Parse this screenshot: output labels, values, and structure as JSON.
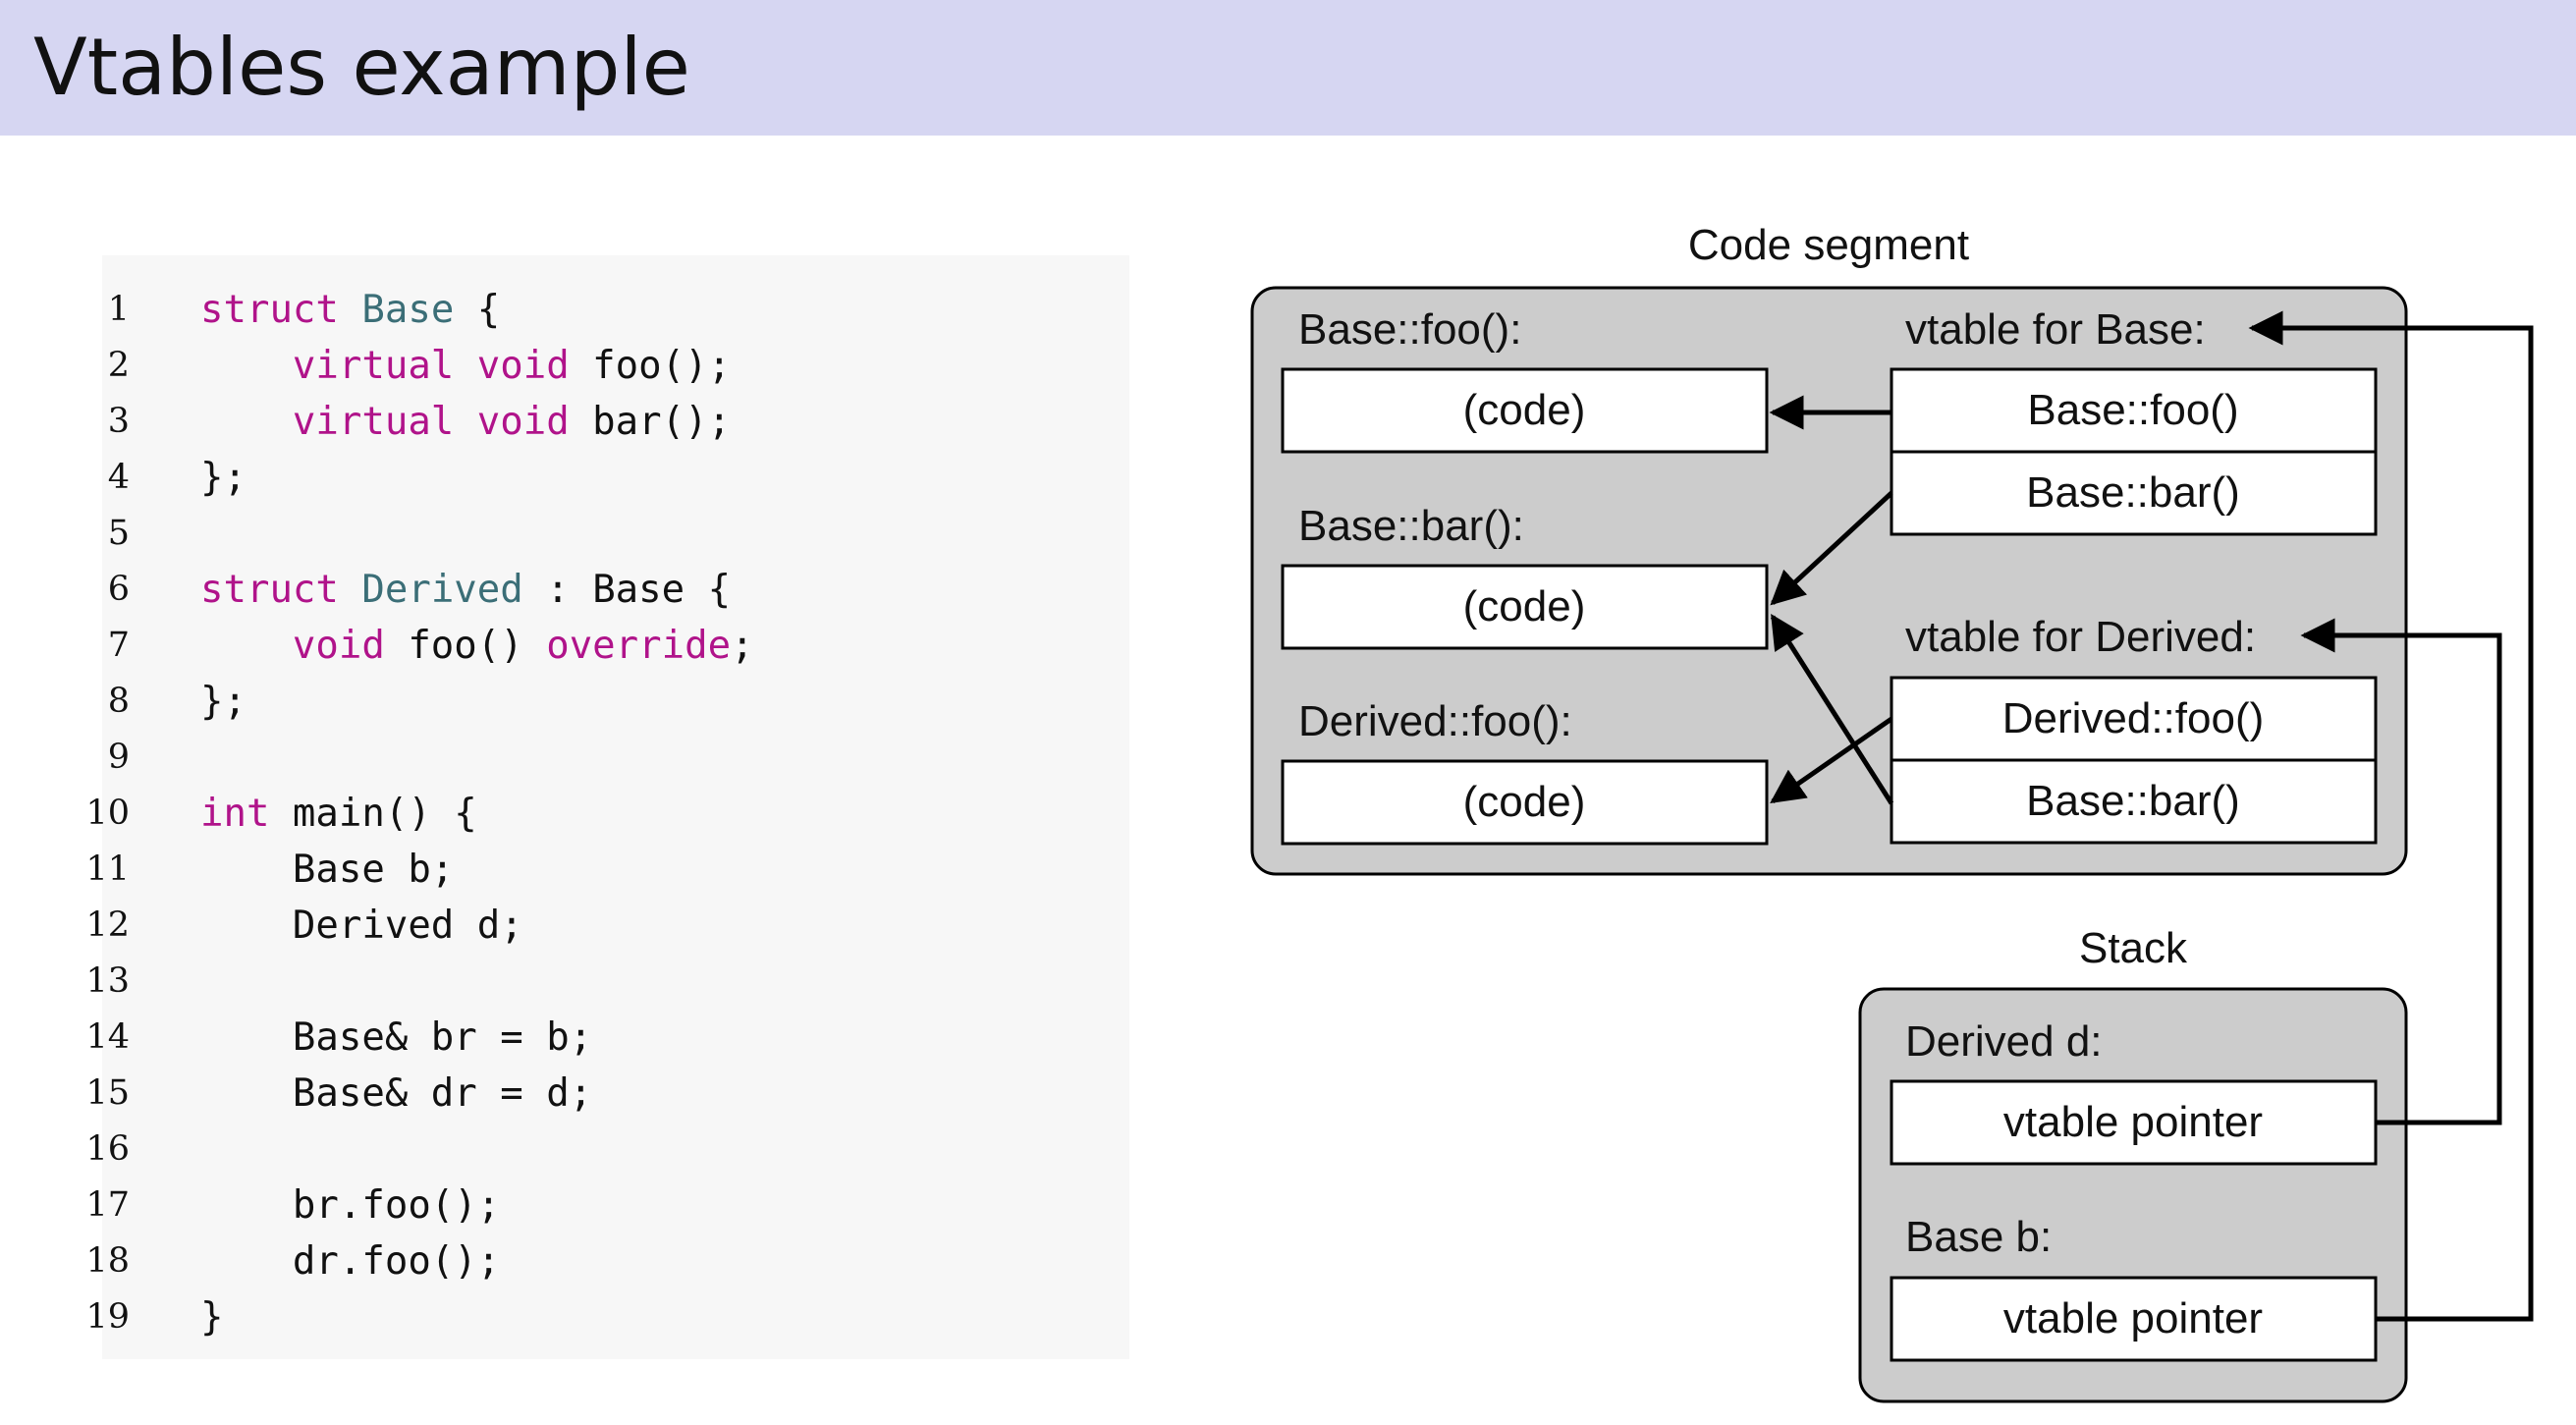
{
  "slide": {
    "title": "Vtables example"
  },
  "code": {
    "lines": [
      {
        "num": "1",
        "tokens": [
          {
            "t": "struct",
            "c": "kw"
          },
          {
            "t": " "
          },
          {
            "t": "Base",
            "c": "ty"
          },
          {
            "t": " {"
          }
        ]
      },
      {
        "num": "2",
        "tokens": [
          {
            "t": "    "
          },
          {
            "t": "virtual",
            "c": "kw"
          },
          {
            "t": " "
          },
          {
            "t": "void",
            "c": "kw"
          },
          {
            "t": " foo();"
          }
        ]
      },
      {
        "num": "3",
        "tokens": [
          {
            "t": "    "
          },
          {
            "t": "virtual",
            "c": "kw"
          },
          {
            "t": " "
          },
          {
            "t": "void",
            "c": "kw"
          },
          {
            "t": " bar();"
          }
        ]
      },
      {
        "num": "4",
        "tokens": [
          {
            "t": "};"
          }
        ]
      },
      {
        "num": "5",
        "tokens": []
      },
      {
        "num": "6",
        "tokens": [
          {
            "t": "struct",
            "c": "kw"
          },
          {
            "t": " "
          },
          {
            "t": "Derived",
            "c": "ty"
          },
          {
            "t": " : Base {"
          }
        ]
      },
      {
        "num": "7",
        "tokens": [
          {
            "t": "    "
          },
          {
            "t": "void",
            "c": "kw"
          },
          {
            "t": " foo() "
          },
          {
            "t": "override",
            "c": "kw"
          },
          {
            "t": ";"
          }
        ]
      },
      {
        "num": "8",
        "tokens": [
          {
            "t": "};"
          }
        ]
      },
      {
        "num": "9",
        "tokens": []
      },
      {
        "num": "10",
        "tokens": [
          {
            "t": "int",
            "c": "kw"
          },
          {
            "t": " main() {"
          }
        ]
      },
      {
        "num": "11",
        "tokens": [
          {
            "t": "    Base b;"
          }
        ]
      },
      {
        "num": "12",
        "tokens": [
          {
            "t": "    Derived d;"
          }
        ]
      },
      {
        "num": "13",
        "tokens": []
      },
      {
        "num": "14",
        "tokens": [
          {
            "t": "    Base& br = b;"
          }
        ]
      },
      {
        "num": "15",
        "tokens": [
          {
            "t": "    Base& dr = d;"
          }
        ]
      },
      {
        "num": "16",
        "tokens": []
      },
      {
        "num": "17",
        "tokens": [
          {
            "t": "    br.foo();"
          }
        ]
      },
      {
        "num": "18",
        "tokens": [
          {
            "t": "    dr.foo();"
          }
        ]
      },
      {
        "num": "19",
        "tokens": [
          {
            "t": "}"
          }
        ]
      }
    ]
  },
  "diagram": {
    "code_segment": {
      "title": "Code segment",
      "base_foo_label": "Base::foo():",
      "base_foo_box": "(code)",
      "base_bar_label": "Base::bar():",
      "base_bar_box": "(code)",
      "derived_foo_label": "Derived::foo():",
      "derived_foo_box": "(code)",
      "vtable_base_label": "vtable for Base:",
      "vtable_base_entries": [
        "Base::foo()",
        "Base::bar()"
      ],
      "vtable_derived_label": "vtable for Derived:",
      "vtable_derived_entries": [
        "Derived::foo()",
        "Base::bar()"
      ]
    },
    "stack": {
      "title": "Stack",
      "derived_label": "Derived d:",
      "derived_box": "vtable pointer",
      "base_label": "Base b:",
      "base_box": "vtable pointer"
    },
    "colors": {
      "panel_fill": "#cccccc",
      "box_fill": "#ffffff",
      "stroke": "#000000"
    }
  }
}
